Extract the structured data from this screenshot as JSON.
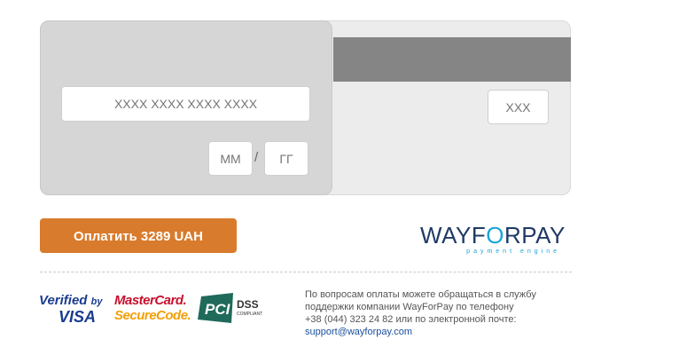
{
  "card": {
    "number_placeholder": "XXXX XXXX XXXX XXXX",
    "month_placeholder": "ММ",
    "year_placeholder": "ГГ",
    "separator": "/",
    "cvv_placeholder": "XXX"
  },
  "pay_button": {
    "label": "Оплатить 3289 UAH"
  },
  "logo": {
    "part1": "WAYF",
    "part2": "O",
    "part3": "RPAY",
    "tagline": "payment engine"
  },
  "badges": {
    "verified_line1": "Verified",
    "verified_by": "by",
    "verified_line2": "VISA",
    "mastercard_line1": "MasterCard.",
    "mastercard_line2": "SecureCode.",
    "pci_text": "PCI",
    "dss_text": "DSS",
    "compliant_text": "COMPLIANT"
  },
  "contact": {
    "line1": "По вопросам оплаты можете обращаться в службу",
    "line2": "поддержки компании WayForPay по телефону",
    "line3": "+38 (044) 323 24 82 или по электронной почте:",
    "email": "support@wayforpay.com"
  },
  "colors": {
    "accent": "#d97b2c",
    "brand_dark": "#1f3a64",
    "brand_light": "#19a4d8",
    "link": "#1a4f9c"
  }
}
